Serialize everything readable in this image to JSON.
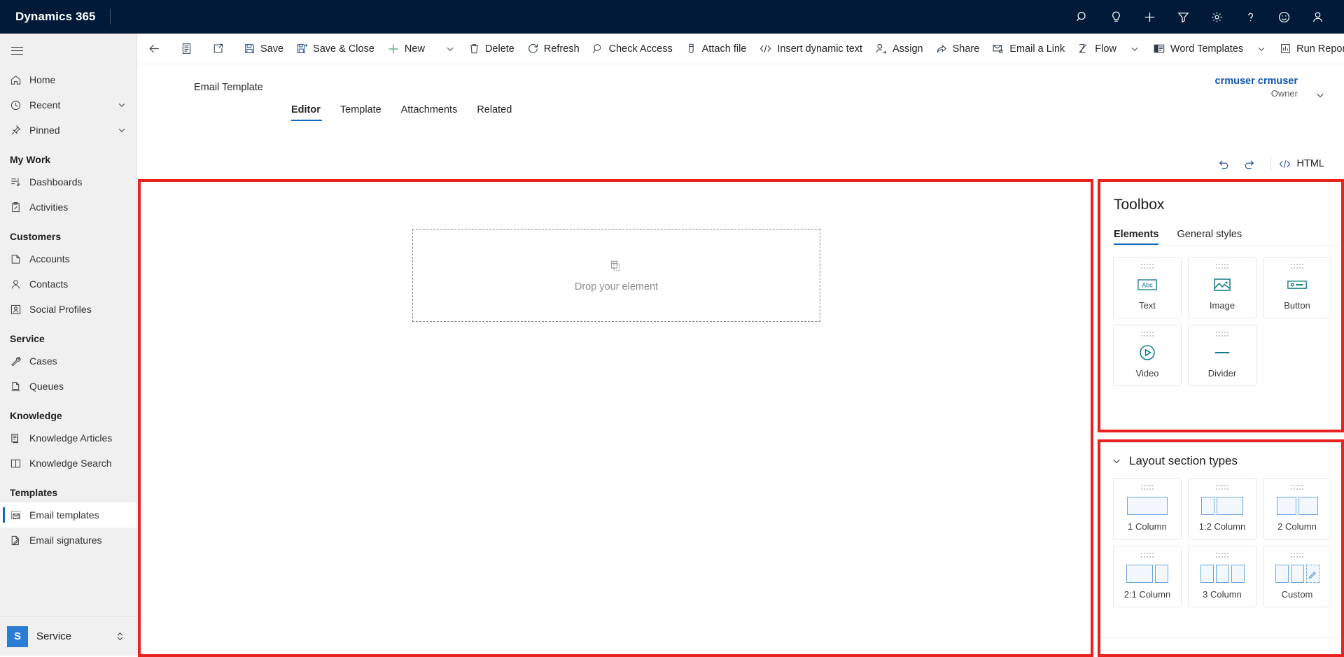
{
  "topnav": {
    "brand": "Dynamics 365",
    "icons": [
      {
        "name": "search-icon",
        "label": "Search"
      },
      {
        "name": "lightbulb-icon",
        "label": "Insights"
      },
      {
        "name": "plus-icon",
        "label": "Quick create"
      },
      {
        "name": "filter-icon",
        "label": "Filter"
      },
      {
        "name": "gear-icon",
        "label": "Settings"
      },
      {
        "name": "help-icon",
        "label": "Help"
      },
      {
        "name": "smiley-icon",
        "label": "Feedback"
      },
      {
        "name": "person-icon",
        "label": "Account manager"
      }
    ]
  },
  "sidebar": {
    "items": [
      {
        "label": "Home",
        "icon": "home-icon",
        "type": "item"
      },
      {
        "label": "Recent",
        "icon": "clock-icon",
        "type": "expandable"
      },
      {
        "label": "Pinned",
        "icon": "pin-icon",
        "type": "expandable"
      },
      {
        "label": "My Work",
        "type": "group"
      },
      {
        "label": "Dashboards",
        "icon": "dashboard-icon",
        "type": "item"
      },
      {
        "label": "Activities",
        "icon": "activities-icon",
        "type": "item"
      },
      {
        "label": "Customers",
        "type": "group"
      },
      {
        "label": "Accounts",
        "icon": "accounts-icon",
        "type": "item"
      },
      {
        "label": "Contacts",
        "icon": "contact-icon",
        "type": "item"
      },
      {
        "label": "Social Profiles",
        "icon": "social-profile-icon",
        "type": "item"
      },
      {
        "label": "Service",
        "type": "group"
      },
      {
        "label": "Cases",
        "icon": "case-icon",
        "type": "item"
      },
      {
        "label": "Queues",
        "icon": "queue-icon",
        "type": "item"
      },
      {
        "label": "Knowledge",
        "type": "group"
      },
      {
        "label": "Knowledge Articles",
        "icon": "article-icon",
        "type": "item"
      },
      {
        "label": "Knowledge Search",
        "icon": "book-icon",
        "type": "item"
      },
      {
        "label": "Templates",
        "type": "group"
      },
      {
        "label": "Email templates",
        "icon": "email-template-icon",
        "type": "item",
        "selected": true
      },
      {
        "label": "Email signatures",
        "icon": "signature-icon",
        "type": "item"
      }
    ],
    "app_switcher": {
      "badge": "S",
      "name": "Service"
    }
  },
  "commandbar": {
    "back_label": "Back",
    "items": [
      {
        "label": "",
        "icon": "form-icon"
      },
      {
        "label": "",
        "icon": "popout-icon"
      },
      {
        "label": "Save",
        "icon": "save-icon"
      },
      {
        "label": "Save & Close",
        "icon": "save-close-icon"
      },
      {
        "label": "New",
        "icon": "plus-icon"
      },
      {
        "label": "Delete",
        "icon": "trash-icon"
      },
      {
        "label": "Refresh",
        "icon": "refresh-icon"
      },
      {
        "label": "Check Access",
        "icon": "check-access-icon"
      },
      {
        "label": "Attach file",
        "icon": "paperclip-icon"
      },
      {
        "label": "Insert dynamic text",
        "icon": "code-icon"
      },
      {
        "label": "Assign",
        "icon": "assign-icon"
      },
      {
        "label": "Share",
        "icon": "share-icon"
      },
      {
        "label": "Email a Link",
        "icon": "email-link-icon"
      },
      {
        "label": "Flow",
        "icon": "flow-icon"
      },
      {
        "label": "Word Templates",
        "icon": "word-icon"
      },
      {
        "label": "Run Report",
        "icon": "report-icon"
      }
    ]
  },
  "record": {
    "title": "Email Template",
    "owner_name": "crmuser crmuser",
    "owner_role": "Owner",
    "tabs": [
      {
        "label": "Editor",
        "active": true
      },
      {
        "label": "Template",
        "active": false
      },
      {
        "label": "Attachments",
        "active": false
      },
      {
        "label": "Related",
        "active": false
      }
    ]
  },
  "editor_tools": {
    "undo": "Undo",
    "redo": "Redo",
    "html_label": "HTML"
  },
  "canvas": {
    "dropzone_text": "Drop your element"
  },
  "toolbox": {
    "title": "Toolbox",
    "tabs": [
      {
        "label": "Elements",
        "active": true
      },
      {
        "label": "General styles",
        "active": false
      }
    ],
    "elements": [
      {
        "label": "Text",
        "icon": "text-abc-icon"
      },
      {
        "label": "Image",
        "icon": "image-icon"
      },
      {
        "label": "Button",
        "icon": "button-icon"
      },
      {
        "label": "Video",
        "icon": "video-play-icon"
      },
      {
        "label": "Divider",
        "icon": "divider-icon"
      }
    ],
    "accent_color": "#0f7b8a"
  },
  "layout_section": {
    "title": "Layout section types",
    "items": [
      {
        "label": "1 Column",
        "icon": "layout-1col-icon",
        "cols": [
          1
        ]
      },
      {
        "label": "1:2 Column",
        "icon": "layout-1-2col-icon",
        "cols": [
          1,
          2
        ]
      },
      {
        "label": "2 Column",
        "icon": "layout-2col-icon",
        "cols": [
          1,
          1
        ]
      },
      {
        "label": "2:1 Column",
        "icon": "layout-2-1col-icon",
        "cols": [
          2,
          1
        ]
      },
      {
        "label": "3 Column",
        "icon": "layout-3col-icon",
        "cols": [
          1,
          1,
          1
        ]
      },
      {
        "label": "Custom",
        "icon": "layout-custom-icon",
        "cols": [
          1,
          1,
          1
        ]
      }
    ],
    "accent_color": "#6ba4de"
  },
  "annotations": {
    "highlight_color": "#e8231f",
    "boxes": [
      "editor-canvas",
      "toolbox-panel",
      "layout-section-panel"
    ]
  }
}
